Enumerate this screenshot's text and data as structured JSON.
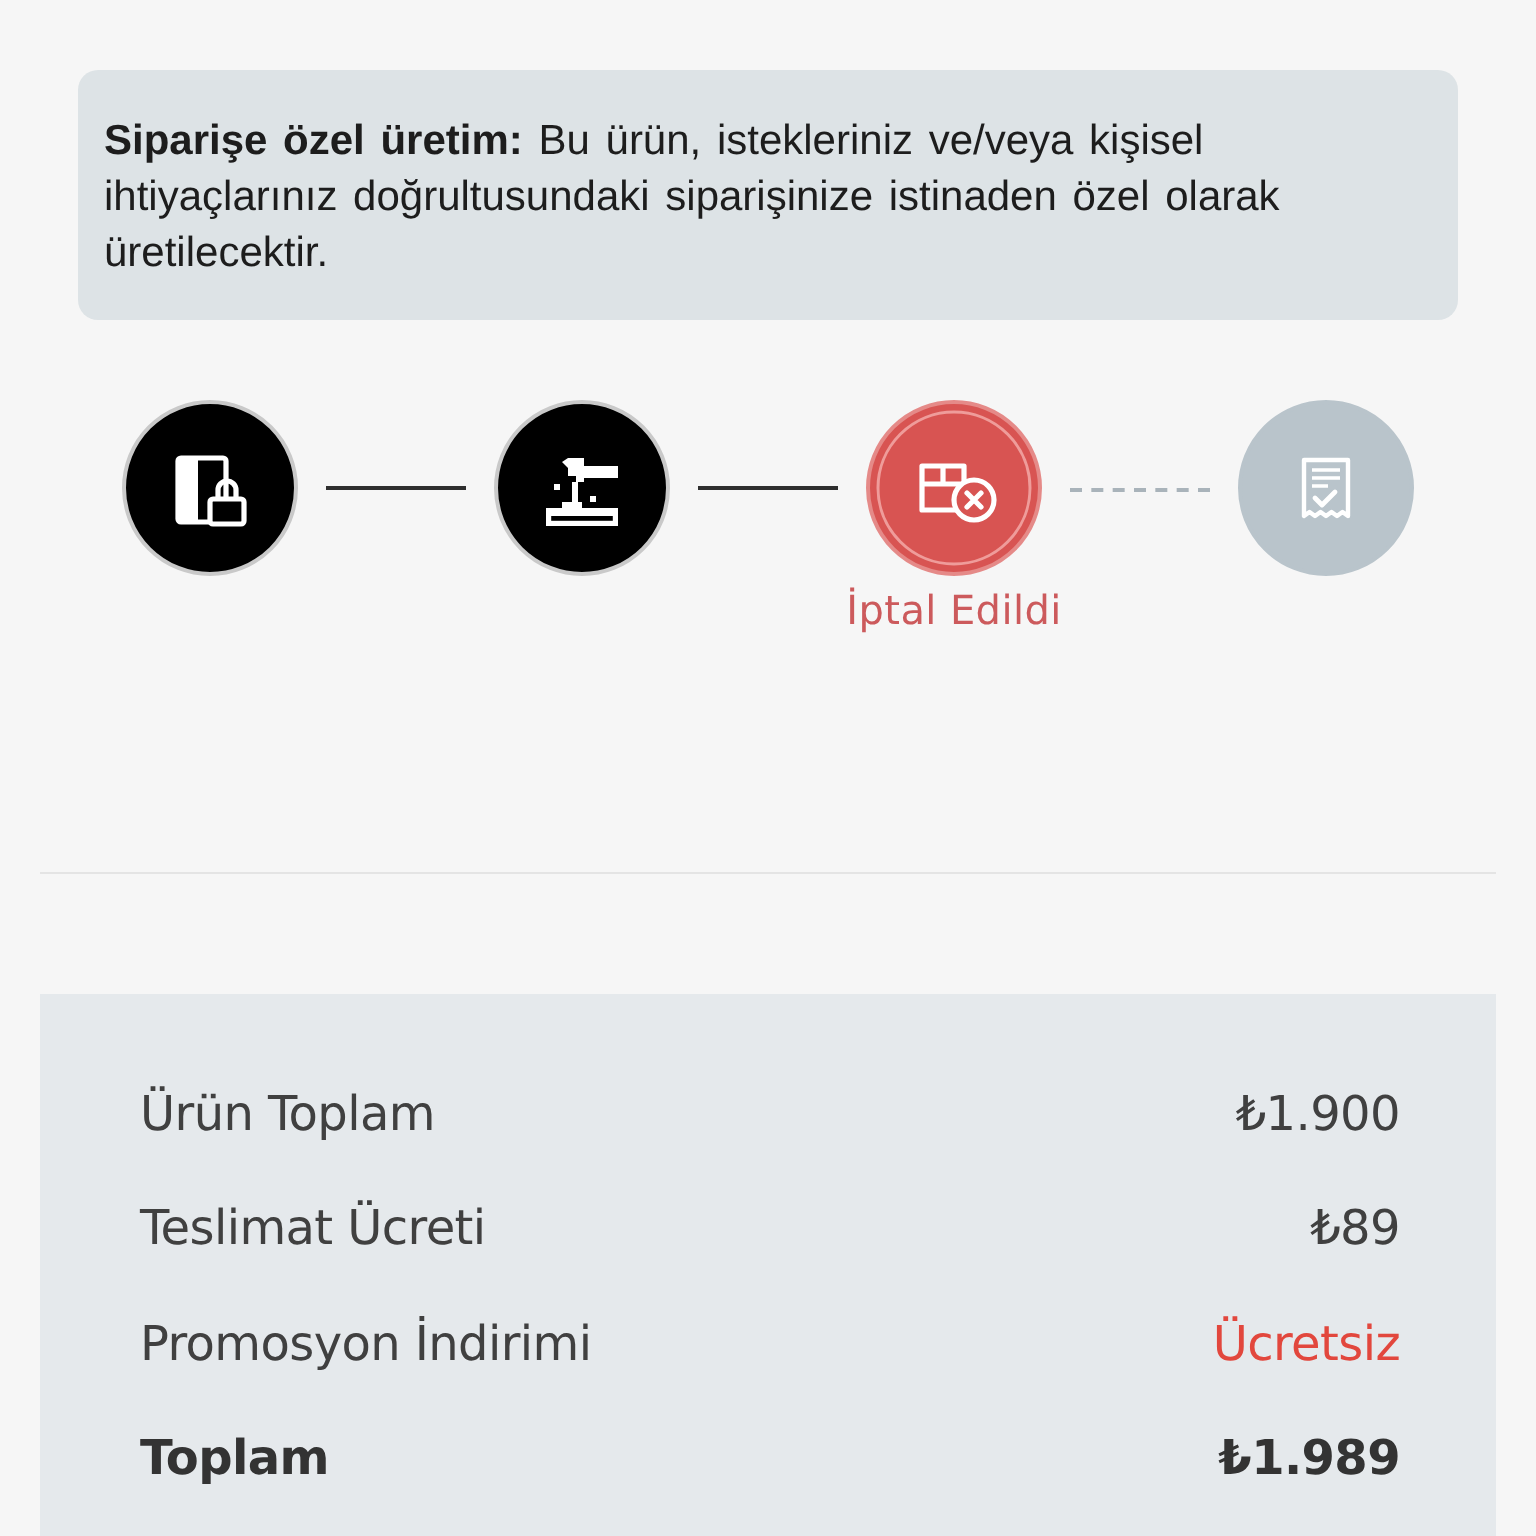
{
  "notice": {
    "text": "**Siparişe özel üretim:** Bu ürün, istekleriniz ve/veya kişisel ihtiyaçlarınız doğrultusundaki siparişinize istinaden özel olarak üretilecektir."
  },
  "steps": [
    {
      "completed": true,
      "cancelled": false
    },
    {
      "completed": true,
      "cancelled": false
    },
    {
      "completed": false,
      "cancelled": true,
      "label": "İptal Edildi"
    },
    {
      "completed": false,
      "cancelled": false
    }
  ],
  "summary": {
    "rows": [
      {
        "kind": "normal",
        "label": "Ürün Toplam",
        "value": "₺1.900"
      },
      {
        "kind": "normal",
        "label": "Teslimat Ücreti",
        "value": "₺89"
      },
      {
        "kind": "discount",
        "label": "Promosyon İndirimi",
        "value": "Ücretsiz"
      },
      {
        "kind": "total",
        "label": "Toplam",
        "value": "₺1.989"
      }
    ]
  }
}
